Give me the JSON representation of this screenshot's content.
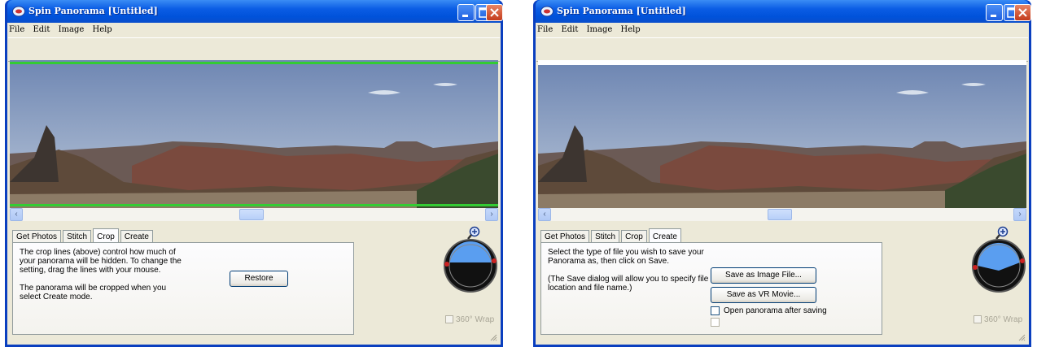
{
  "left": {
    "title": "Spin Panorama [Untitled]",
    "menu": [
      "File",
      "Edit",
      "Image",
      "Help"
    ],
    "tabs": [
      "Get Photos",
      "Stitch",
      "Crop",
      "Create"
    ],
    "active_tab": "Crop",
    "panel_text": [
      "The crop lines (above) control how much of your panorama will be hidden. To change the setting, drag the lines with your mouse.",
      "The panorama will be cropped when you select Create mode."
    ],
    "restore_label": "Restore",
    "wrap_label": "360° Wrap"
  },
  "right": {
    "title": "Spin Panorama [Untitled]",
    "menu": [
      "File",
      "Edit",
      "Image",
      "Help"
    ],
    "tabs": [
      "Get Photos",
      "Stitch",
      "Crop",
      "Create"
    ],
    "active_tab": "Create",
    "panel_text": [
      "Select the type of file you wish to save your Panorama as, then click on Save.",
      "(The Save dialog will allow you to specify file location and file name.)"
    ],
    "save_image_label": "Save as Image File...",
    "save_vr_label": "Save as VR Movie...",
    "open_after_label": "Open panorama after saving",
    "wrap_label": "360° Wrap"
  },
  "icons": [
    "app-icon",
    "minimize-icon",
    "maximize-icon",
    "close-icon",
    "zoom-in-icon",
    "zoom-out-icon",
    "compass-dial-icon",
    "resize-grip-icon"
  ],
  "colors": {
    "titlebar": "#0054e3",
    "crop_line": "#33cc33",
    "dial_sky": "#5a9ef0"
  }
}
